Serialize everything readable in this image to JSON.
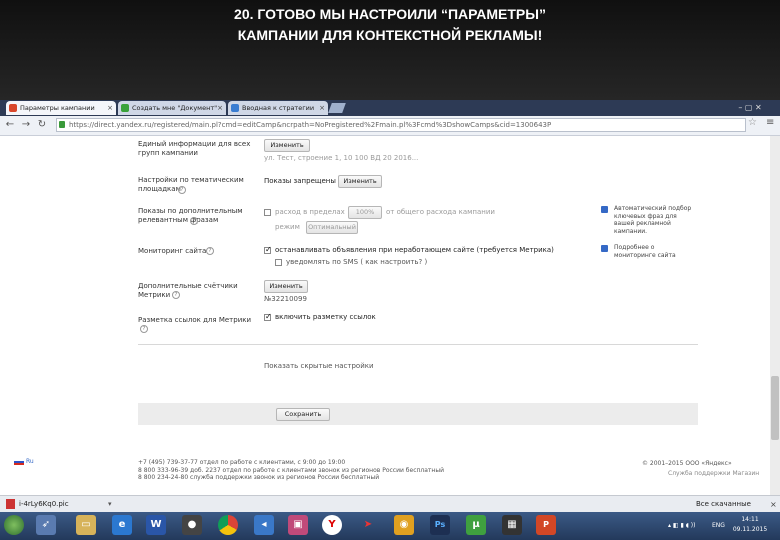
{
  "slide": {
    "title": "20. ГОТОВО МЫ НАСТРОИЛИ “ПАРАМЕТРЫ”\nКАМПАНИИ ДЛЯ КОНТЕКСТНОЙ РЕКЛАМЫ!"
  },
  "tabs": [
    {
      "label": "Параметры кампании",
      "icon_color": "#d9472b",
      "active": true
    },
    {
      "label": "Создать мне \"Документ\"",
      "icon_color": "#3aa23a",
      "active": false
    },
    {
      "label": "Вводная к стратегии",
      "icon_color": "#3a7dd1",
      "active": false
    }
  ],
  "address": {
    "url": "https://direct.yandex.ru/registered/main.pl?cmd=editCamp&ncrpath=NoPregistered%2Fmain.pl%3Fcmd%3DshowCamps&cid=1300643P"
  },
  "window_buttons": "–  ▢  ✕",
  "form": {
    "row_ad_label": "Единый информации для всех\nгрупп кампании",
    "change_btn": "Изменить",
    "row_ad_value": "ул. Тест, строение 1, 10 100 ВД 20 2016...",
    "row_places_label": "Настройки по тематическим\nплощадкам",
    "row_places_value": "Показы запрещены",
    "row_extra_label": "Показы по дополнительным\nрелевантным фразам",
    "row_extra_check": "расход в пределах",
    "row_extra_percent": "100%",
    "row_extra_tail": "от общего расхода кампании",
    "row_extra_mode_lbl": "режим",
    "row_extra_mode_val": "Оптимальный",
    "row_extra_hint": "Автоматический подбор ключевых фраз для вашей рекламной кампании.",
    "row_monitor_label": "Мониторинг сайта",
    "row_monitor_check1": "останавливать объявления при неработающем сайте (требуется Метрика)",
    "row_monitor_check2": "уведомлять по SMS ( как настроить? )",
    "row_monitor_hint": "Подробнее о мониторинге сайта",
    "row_counters_label": "Дополнительные счётчики\nМетрики",
    "row_counters_value": "№32210099",
    "row_utm_label": "Разметка ссылок для Метрики",
    "row_utm_check": "включить разметку ссылок",
    "show_hidden": "Показать скрытые настройки",
    "save_btn": "Сохранить"
  },
  "footer": {
    "lang": "Ru",
    "contacts": "+7 (495) 739-37-77 отдел по работе с клиентами, с 9:00 до 19:00\n8 800 333-96-39 доб. 2237 отдел по работе с клиентами звонок из регионов России бесплатный\n8 800 234-24-80 служба поддержки звонок из регионов России бесплатный",
    "copyright": "© 2001–2015 ООО «Яндекс»",
    "links": "Служба поддержки    Магазин"
  },
  "downloads": {
    "file": "i-4rLy6Kq0.pic",
    "show_all": "Все скачанные файлы..."
  },
  "taskbar": {
    "lang": "ENG",
    "time": "14:11",
    "date": "09.11.2015"
  },
  "colors": {
    "accent_link": "#3569c6",
    "taskbar": "#2b4470"
  }
}
